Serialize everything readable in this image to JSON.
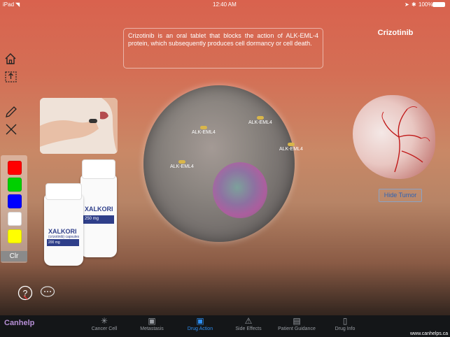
{
  "status": {
    "device": "iPad",
    "time": "12:40 AM",
    "battery": "100%"
  },
  "drug_title": "Crizotinib",
  "description": "Crizotinib is an oral tablet that blocks the action of ALK-EML-4 protein, which subsequently produces cell dormancy or cell death.",
  "receptors": [
    "ALK-EML4",
    "ALK-EML4",
    "ALK-EML4",
    "ALK-EML4"
  ],
  "hide_tumor_label": "Hide Tumor",
  "palette": {
    "colors": [
      "#ff0000",
      "#00d000",
      "#0000ff",
      "#ffffff",
      "#ffff00"
    ],
    "clear_label": "Clr"
  },
  "bottle": {
    "brand": "XALKORI",
    "generic": "(crizotinib) capsules",
    "dose": "250 mg",
    "dose_small": "200 mg"
  },
  "tabs": [
    {
      "label": "Cancer Cell",
      "icon": "cell-icon"
    },
    {
      "label": "Metastasis",
      "icon": "film-icon"
    },
    {
      "label": "Drug Action",
      "icon": "pill-bag-icon"
    },
    {
      "label": "Side Effects",
      "icon": "warning-icon"
    },
    {
      "label": "Patient Guidance",
      "icon": "clipboard-icon"
    },
    {
      "label": "Drug Info",
      "icon": "document-icon"
    }
  ],
  "active_tab": "Drug Action",
  "brand": "Canhelp",
  "website": "www.canhelps.ca"
}
